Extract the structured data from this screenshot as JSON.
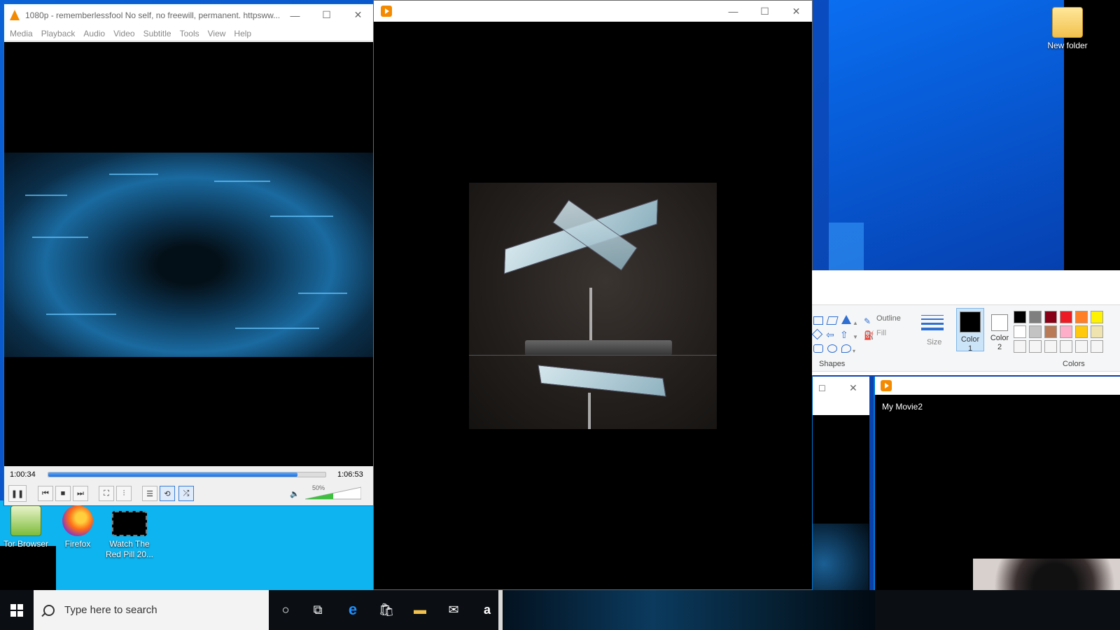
{
  "vlc": {
    "title": "1080p - rememberlessfool No self, no freewill, permanent. httpsww...",
    "menu": [
      "Media",
      "Playback",
      "Audio",
      "Video",
      "Subtitle",
      "Tools",
      "View",
      "Help"
    ],
    "time_elapsed": "1:00:34",
    "time_total": "1:06:53",
    "seek_progress": 0.9,
    "volume_label": "50%",
    "volume_level": 0.5
  },
  "movies_window": {
    "minimize": "—",
    "maximize": "☐",
    "close": "✕"
  },
  "paint": {
    "group_shapes": "Shapes",
    "outline": "Outline",
    "fill": "Fill",
    "size": "Size",
    "color1": "Color\n1",
    "color2": "Color\n2",
    "color1_label_a": "Color",
    "color1_label_b": "1",
    "color2_label_a": "Color",
    "color2_label_b": "2",
    "group_colors": "Colors",
    "palette": [
      "#000000",
      "#7f7f7f",
      "#880015",
      "#ed1c24",
      "#ff7f27",
      "#fff200",
      "#ffffff",
      "#c3c3c3",
      "#b97a57",
      "#ffaec9",
      "#ffc90e",
      "#efe4b0",
      "#f5f5f5",
      "#f5f5f5",
      "#f5f5f5",
      "#f5f5f5",
      "#f5f5f5",
      "#f5f5f5"
    ]
  },
  "my_movie": {
    "title": "My Movie2"
  },
  "desktop": {
    "new_folder": "New folder",
    "tor_browser": "Tor Browser",
    "firefox": "Firefox",
    "red_pill_line1": "Watch The",
    "red_pill_line2": "Red Pill 20..."
  },
  "taskbar": {
    "search_placeholder": "Type here to search"
  }
}
